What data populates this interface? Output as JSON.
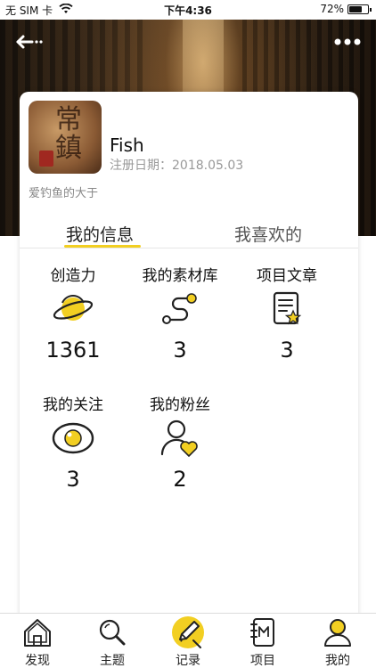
{
  "status_bar": {
    "carrier": "无 SIM 卡",
    "time": "下午4:36",
    "battery": "72%",
    "battery_level": 0.72
  },
  "header": {
    "back_icon": "arrow-left-icon",
    "more_icon": "more-dots-icon"
  },
  "profile": {
    "username": "Fish",
    "reg_label": "注册日期：",
    "reg_date": "2018.05.03",
    "bio": "爱钓鱼的大于"
  },
  "tabs": [
    {
      "label": "我的信息",
      "active": true
    },
    {
      "label": "我喜欢的",
      "active": false
    }
  ],
  "stats": [
    {
      "label": "创造力",
      "value": "1361",
      "icon": "planet-icon"
    },
    {
      "label": "我的素材库",
      "value": "3",
      "icon": "path-nodes-icon"
    },
    {
      "label": "项目文章",
      "value": "3",
      "icon": "article-star-icon"
    },
    {
      "label": "我的关注",
      "value": "3",
      "icon": "eye-icon"
    },
    {
      "label": "我的粉丝",
      "value": "2",
      "icon": "fan-heart-icon"
    }
  ],
  "tabbar": [
    {
      "label": "发现",
      "icon": "home-icon"
    },
    {
      "label": "主题",
      "icon": "search-icon"
    },
    {
      "label": "记录",
      "icon": "pen-record-icon"
    },
    {
      "label": "项目",
      "icon": "notebook-icon"
    },
    {
      "label": "我的",
      "icon": "user-icon"
    }
  ],
  "colors": {
    "accent": "#f2cf22",
    "text": "#111111",
    "muted": "#999999"
  }
}
